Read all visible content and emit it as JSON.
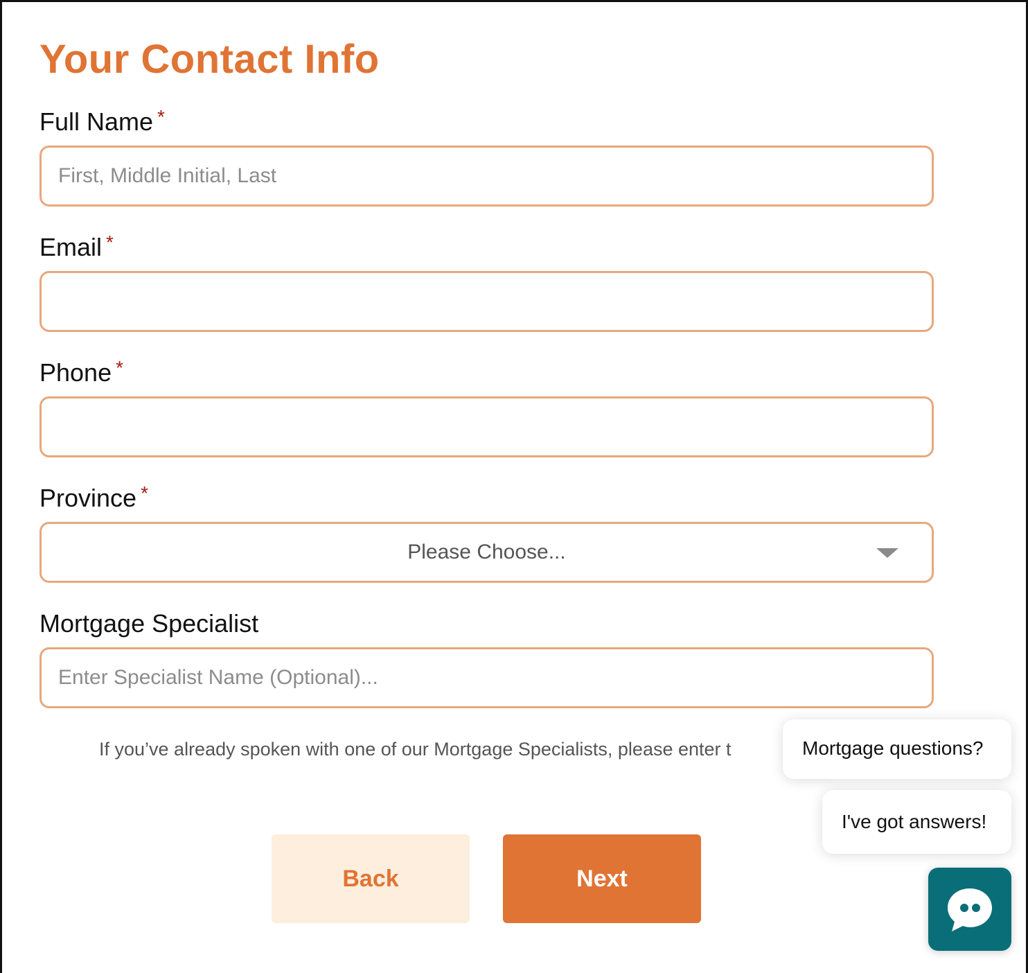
{
  "form": {
    "title": "Your Contact Info",
    "required_marker": "*",
    "full_name": {
      "label": "Full Name",
      "placeholder": "First, Middle Initial, Last",
      "value": ""
    },
    "email": {
      "label": "Email",
      "placeholder": "",
      "value": ""
    },
    "phone": {
      "label": "Phone",
      "placeholder": "",
      "value": ""
    },
    "province": {
      "label": "Province",
      "selected": "Please Choose..."
    },
    "specialist": {
      "label": "Mortgage Specialist",
      "placeholder": "Enter Specialist Name (Optional)...",
      "value": "",
      "helper": "If you’ve already spoken with one of our Mortgage Specialists, please enter t"
    },
    "buttons": {
      "back": "Back",
      "next": "Next"
    }
  },
  "chat": {
    "bubble_1": "Mortgage questions?",
    "bubble_2": "I've got answers!",
    "icon": "chat-bubble-icon"
  },
  "colors": {
    "accent": "#e07434",
    "input_border": "#e8a77c",
    "back_bg": "#fdeede",
    "chat_bg": "#0a6e78",
    "required": "#a61c0e"
  }
}
